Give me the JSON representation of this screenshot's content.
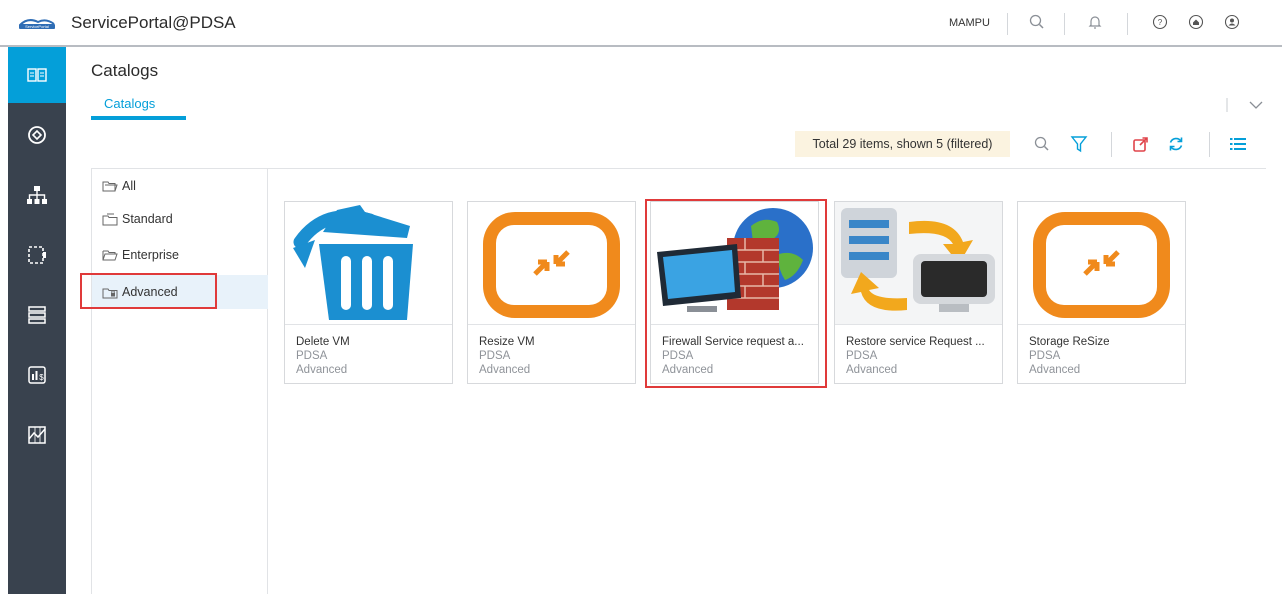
{
  "header": {
    "logo_text": "ServicePortal",
    "app_title": "ServicePortal@PDSA",
    "user": "MAMPU",
    "icons": [
      "search-icon",
      "bell-icon",
      "help-icon",
      "home-icon",
      "profile-icon"
    ]
  },
  "leftnav": {
    "items": [
      {
        "icon": "catalog-book-icon",
        "active": true
      },
      {
        "icon": "services-icon",
        "active": false
      },
      {
        "icon": "hierarchy-icon",
        "active": false
      },
      {
        "icon": "resource-frame-icon",
        "active": false
      },
      {
        "icon": "server-stack-icon",
        "active": false
      },
      {
        "icon": "chargeback-report-icon",
        "active": false
      },
      {
        "icon": "analytics-chart-icon",
        "active": false
      }
    ]
  },
  "page": {
    "title": "Catalogs",
    "tabs": [
      {
        "label": "Catalogs",
        "active": true
      }
    ]
  },
  "toolbar": {
    "summary": "Total 29 items, shown 5 (filtered)",
    "icons": [
      "search-icon",
      "filter-icon",
      "export-icon",
      "refresh-icon",
      "list-view-icon"
    ]
  },
  "tree": {
    "items": [
      {
        "label": "All",
        "selected": false
      },
      {
        "label": "Standard",
        "selected": false
      },
      {
        "label": "Enterprise",
        "selected": false
      },
      {
        "label": "Advanced",
        "selected": true
      }
    ]
  },
  "cards": [
    {
      "name": "Delete VM",
      "group": "PDSA",
      "category": "Advanced",
      "image": "trash-bin-image"
    },
    {
      "name": "Resize VM",
      "group": "PDSA",
      "category": "Advanced",
      "image": "resize-arrows-image"
    },
    {
      "name": "Firewall Service request a...",
      "group": "PDSA",
      "category": "Advanced",
      "image": "firewall-globe-image"
    },
    {
      "name": "Restore service Request ...",
      "group": "PDSA",
      "category": "Advanced",
      "image": "restore-server-image"
    },
    {
      "name": "Storage ReSize",
      "group": "PDSA",
      "category": "Advanced",
      "image": "resize-arrows-image"
    }
  ],
  "colors": {
    "accent": "#049fd9",
    "nav_bg": "#39424e",
    "highlight_box": "#e03a3a",
    "summary_bg": "#fbf3e0",
    "card_orange": "#f08a1c"
  }
}
